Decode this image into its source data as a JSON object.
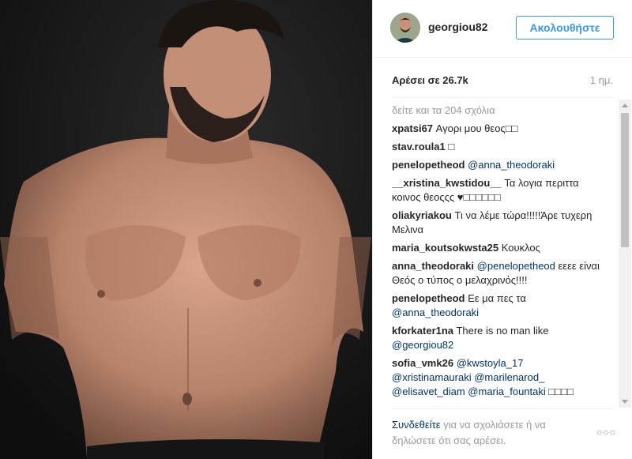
{
  "post": {
    "username": "georgiou82",
    "follow_label": "Ακολουθήστε",
    "likes": "Αρέσει σε 26.7k",
    "time": "1 ημ.",
    "view_all": "δείτε και τα 204 σχόλια"
  },
  "comments": [
    {
      "user": "xpatsi67",
      "text": "Αγορι μου θεος□□"
    },
    {
      "user": "stav.roula1",
      "text": "□"
    },
    {
      "user": "penelopetheod",
      "text": "",
      "mention": "@anna_theodoraki"
    },
    {
      "user": "__xristina_kwstidou__",
      "text": "Τα λογια περιττα κοινος θεοςςς ♥□□□□□□"
    },
    {
      "user": "oliakyriakou",
      "text": "Τι να λέμε τώρα!!!!!Άρε τυχερη Μελινα"
    },
    {
      "user": "maria_koutsokwsta25",
      "text": "Κουκλος"
    },
    {
      "user": "anna_theodoraki",
      "mention": "@penelopetheod",
      "text": "εεεε είναι Θεός ο τύπος ο μελαχρινός!!!!"
    },
    {
      "user": "penelopetheod",
      "text": "Εε μα πες τα",
      "mention_after": "@anna_theodoraki"
    },
    {
      "user": "kforkater1na",
      "text": "There is no man like",
      "mention_after": "@georgiou82"
    },
    {
      "user": "sofia_vmk26",
      "mention": "@kwstoyla_17",
      "text": "",
      "mention_after": "@xristinamauraki @marilenarod_ @elisavet_diam @maria_fountaki",
      "tail": "□□□□"
    }
  ],
  "footer": {
    "login_link": "Συνδεθείτε",
    "text": "για να σχολιάσετε ή να δηλώσετε ότι σας αρέσει.",
    "more": "○○○"
  }
}
